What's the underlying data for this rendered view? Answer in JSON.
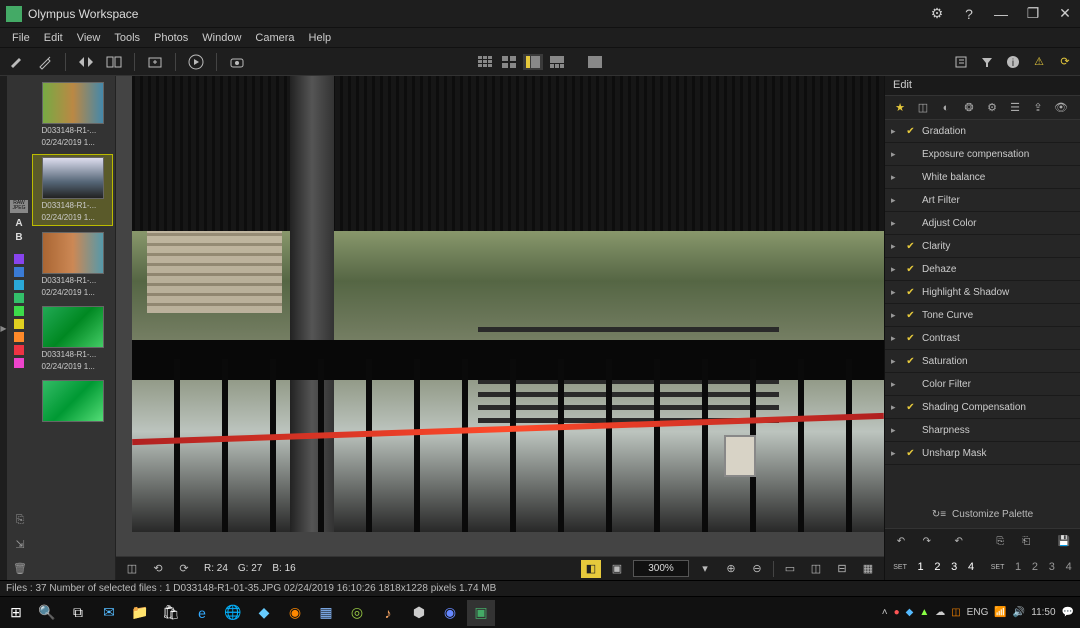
{
  "title": "Olympus Workspace",
  "menu": [
    "File",
    "Edit",
    "View",
    "Tools",
    "Photos",
    "Window",
    "Camera",
    "Help"
  ],
  "thumbnails": [
    {
      "name": "D033148-R1-...",
      "date": "02/24/2019 1..."
    },
    {
      "name": "D033148-R1-...",
      "date": "02/24/2019 1..."
    },
    {
      "name": "D033148-R1-...",
      "date": "02/24/2019 1..."
    },
    {
      "name": "D033148-R1-...",
      "date": "02/24/2019 1..."
    }
  ],
  "raw_label": "RAW\nJPEG",
  "labelA": "A",
  "labelB": "B",
  "colortags": [
    "#8844ee",
    "#3a7bd5",
    "#2aa8d8",
    "#33c06a",
    "#3cdc4a",
    "#e0d020",
    "#ff8a2a",
    "#ee3344",
    "#ee44cc"
  ],
  "rgb": {
    "r": "R: 24",
    "g": "G: 27",
    "b": "B: 16"
  },
  "zoom": "300%",
  "edit_header": "Edit",
  "sections": [
    {
      "label": "Gradation",
      "chk": true
    },
    {
      "label": "Exposure compensation",
      "chk": false
    },
    {
      "label": "White balance",
      "chk": false
    },
    {
      "label": "Art Filter",
      "chk": false
    },
    {
      "label": "Adjust Color",
      "chk": false
    },
    {
      "label": "Clarity",
      "chk": true
    },
    {
      "label": "Dehaze",
      "chk": true
    },
    {
      "label": "Highlight & Shadow",
      "chk": true
    },
    {
      "label": "Tone Curve",
      "chk": true
    },
    {
      "label": "Contrast",
      "chk": true
    },
    {
      "label": "Saturation",
      "chk": true
    },
    {
      "label": "Color Filter",
      "chk": false
    },
    {
      "label": "Shading Compensation",
      "chk": true
    },
    {
      "label": "Sharpness",
      "chk": false
    },
    {
      "label": "Unsharp Mask",
      "chk": true
    }
  ],
  "customize": "Customize Palette",
  "set_label": "SET",
  "statusbar": "Files : 37   Number of selected files : 1   D033148-R1-01-35.JPG   02/24/2019 16:10:26   1818x1228 pixels   1.74 MB",
  "clock_time": "11:50",
  "tray_lang": "ENG"
}
